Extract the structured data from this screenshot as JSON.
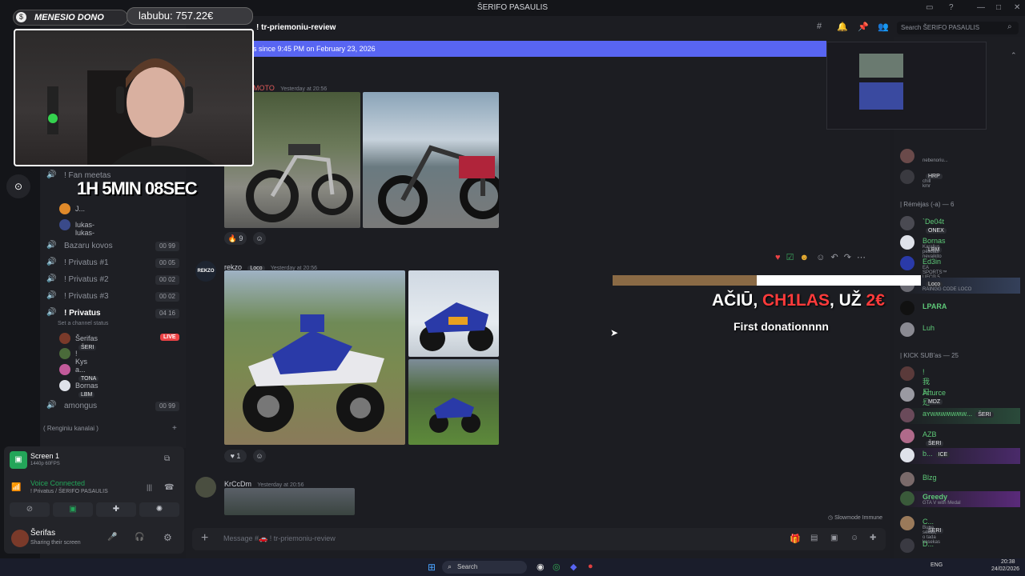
{
  "window": {
    "title": "ŠERIFO PASAULIS"
  },
  "server": {
    "name": "ŠERIFO PASAULIS"
  },
  "stream_overlay": {
    "donation_label": "MENESIO DONO",
    "donation_value": "labubu: 757.22€",
    "timer": "1H 5MIN 08SEC",
    "alert_prefix": "AČIŪ, ",
    "alert_name": "CH1LAS",
    "alert_mid": ", UŽ ",
    "alert_amount": "2€",
    "alert_message": "First donationnnn",
    "accent_color": "#ff3b3b"
  },
  "channels": [
    {
      "label": "! Fan meetas",
      "icon": "speaker-icon"
    },
    {
      "label": "Bazaru kovos",
      "count": "00 99"
    },
    {
      "label": "! Privatus #1",
      "count": "00 05"
    },
    {
      "label": "! Privatus #2",
      "count": "00 02"
    },
    {
      "label": "! Privatus #3",
      "count": "00 02"
    },
    {
      "label": "! Privatus",
      "count": "04 16",
      "status": "Set a channel status"
    },
    {
      "label": "amongus",
      "count": "00 99"
    }
  ],
  "fanmeet_members": [
    "J...",
    "lukas-lukas-"
  ],
  "privatus_members": [
    {
      "name": "Šerifas",
      "tag": "ŠERI",
      "live": "LIVE"
    },
    {
      "name": "! Kys"
    },
    {
      "name": "a...",
      "tag": "TONA"
    },
    {
      "name": "Bornas",
      "tag": "LBM"
    }
  ],
  "channel_footer": "( Renginiu kanalai )",
  "screen_share": {
    "title": "Screen 1",
    "quality": "1440p 60FPS"
  },
  "voice": {
    "status": "Voice Connected",
    "channel": "! Privatus / ŠERIFO PASAULIS"
  },
  "user": {
    "name": "Šerifas",
    "status": "Sharing their screen"
  },
  "chat": {
    "channel_name": "! tr-priemoniu-review",
    "banner": "s since 9:45 PM on February 23, 2026",
    "messages": [
      {
        "author": "MOTO",
        "time": "Yesterday at 20:56",
        "reaction_count": "9"
      },
      {
        "author": "rekzo",
        "tag": "Loco",
        "time": "Yesterday at 20:56",
        "reaction_count": "1",
        "avatar_text": "REKZO"
      },
      {
        "author": "KrCcDm",
        "time": "Yesterday at 20:56"
      }
    ],
    "slowmode": "Slowmode Immune",
    "input_placeholder": "Message #🚗 ! tr-priemoniu-review"
  },
  "search": {
    "placeholder": "Search ŠERIFO PASAULIS"
  },
  "member_list": {
    "top": [
      {
        "name": "",
        "sub": "nebenoriu...",
        "color": "#c0392b"
      },
      {
        "name": "",
        "tag": "HRP",
        "sub": "chill kmr",
        "color": "#c0392b"
      }
    ],
    "remejai_header": "| Rėmėjas (-a) — 6",
    "remejai": [
      {
        "name": "`De04t",
        "tag": "ONEX",
        "color": "#5ec978"
      },
      {
        "name": "Bornas",
        "tag": "LBM",
        "sub": "Karalius pėsčias nevaikito",
        "color": "#5ec978"
      },
      {
        "name": "Ed3in",
        "sub": "EA SPORTS™ UFC® 5",
        "color": "#5ec978"
      },
      {
        "name": "",
        "tag": "Loco",
        "sub": "RAINGG CODE LOCO",
        "color": "#5ec978"
      },
      {
        "name": "LPARA",
        "color": "#5ec978"
      },
      {
        "name": "Luh",
        "color": "#5ec978"
      }
    ],
    "kick_header": "| KICK SUB'as — 25",
    "kick": [
      {
        "name": "! 我只是好",
        "color": "#5ec978"
      },
      {
        "name": "Arturce",
        "tag": "MDZ",
        "color": "#5ec978"
      },
      {
        "name": "aʏwʍwʍwʍw...",
        "tag": "ŠERI",
        "color": "#5ec978"
      },
      {
        "name": "AZB",
        "tag": "ŠERI",
        "color": "#5ec978"
      },
      {
        "name": "b...",
        "tag": "ICE",
        "color": "#5ec978"
      },
      {
        "name": "Blzg",
        "color": "#5ec978"
      },
      {
        "name": "Greedy",
        "sub": "GTA V with Medal",
        "color": "#5ec978"
      },
      {
        "name": "C...",
        "tag": "ŠERI",
        "sub": "Buna sekas, o tada kasekas",
        "color": "#5ec978"
      },
      {
        "name": "D...",
        "color": "#5ec978"
      }
    ]
  },
  "taskbar": {
    "search": "Search",
    "lang": "ENG",
    "time": "20:38",
    "date": "24/02/2026"
  }
}
